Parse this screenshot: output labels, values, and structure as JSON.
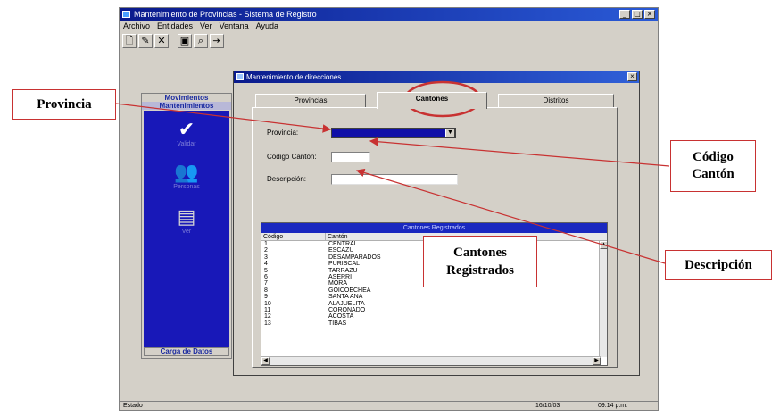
{
  "app": {
    "title": "Mantenimiento de Provincias - Sistema de Registro",
    "menu": [
      "Archivo",
      "Entidades",
      "Ver",
      "Ventana",
      "Ayuda"
    ],
    "toolbar_icons": [
      "new-icon",
      "open-icon",
      "delete-icon",
      "save-icon",
      "find-icon",
      "exit-icon"
    ]
  },
  "sidebar": {
    "header_primary": "Movimientos",
    "header_active": "Mantenimientos",
    "items": [
      {
        "icon": "checkmark-icon",
        "label": "Validar"
      },
      {
        "icon": "people-icon",
        "label": "Personas"
      },
      {
        "icon": "document-icon",
        "label": "Ver"
      }
    ],
    "footer": "Carga de Datos"
  },
  "dialog": {
    "title": "Mantenimiento de direcciones",
    "tabs": [
      "Provincias",
      "Cantones",
      "Distritos"
    ],
    "active_tab": "Cantones",
    "fields": {
      "provincia_label": "Provincia:",
      "provincia_value": "",
      "codigo_label": "Código Cantón:",
      "codigo_value": "",
      "descripcion_label": "Descripción:",
      "descripcion_value": ""
    },
    "grid": {
      "caption": "Cantones Registrados",
      "columns": [
        "Código",
        "Cantón"
      ],
      "rows": [
        [
          "1",
          "CENTRAL"
        ],
        [
          "2",
          "ESCAZU"
        ],
        [
          "3",
          "DESAMPARADOS"
        ],
        [
          "4",
          "PURISCAL"
        ],
        [
          "5",
          "TARRAZU"
        ],
        [
          "6",
          "ASERRI"
        ],
        [
          "7",
          "MORA"
        ],
        [
          "8",
          "GOICOECHEA"
        ],
        [
          "9",
          "SANTA ANA"
        ],
        [
          "10",
          "ALAJUELITA"
        ],
        [
          "11",
          "CORONADO"
        ],
        [
          "12",
          "ACOSTA"
        ],
        [
          "13",
          "TIBAS"
        ]
      ]
    }
  },
  "status": {
    "left": "Estado",
    "date": "16/10/03",
    "time": "09:14 p.m."
  },
  "annotations": {
    "provincia": "Provincia",
    "codigo": "Código Cantón",
    "cantones": "Cantones Registrados",
    "descripcion": "Descripción",
    "highlight_color": "#c83232"
  }
}
